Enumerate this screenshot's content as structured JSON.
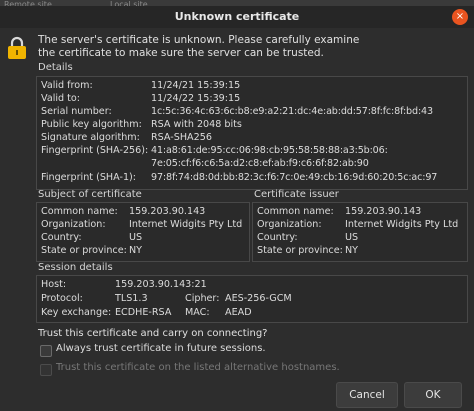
{
  "background": {
    "tabs": [
      "Remote site",
      "Local site"
    ]
  },
  "dialog": {
    "title": "Unknown certificate",
    "close_symbol": "×",
    "message_line1": "The server's certificate is unknown. Please carefully examine",
    "message_line2": "the certificate to make sure the server can be trusted.",
    "details": {
      "title": "Details",
      "rows": [
        {
          "label": "Valid from:",
          "value": "11/24/21 15:39:15"
        },
        {
          "label": "Valid to:",
          "value": "11/24/22 15:39:15"
        },
        {
          "label": "Serial number:",
          "value": "1c:5c:36:4c:63:6c:b8:e9:a2:21:dc:4e:ab:dd:57:8f:fc:8f:bd:43"
        },
        {
          "label": "Public key algorithm:",
          "value": "RSA with 2048 bits"
        },
        {
          "label": "Signature algorithm:",
          "value": "RSA-SHA256"
        },
        {
          "label": "Fingerprint (SHA-256):",
          "value": "41:a8:61:de:95:cc:06:98:cb:95:58:58:88:a3:5b:06:"
        },
        {
          "label": "",
          "value": "7e:05:cf:f6:c6:5a:d2:c8:ef:ab:f9:c6:6f:82:ab:90"
        },
        {
          "label": "Fingerprint (SHA-1):",
          "value": "97:8f:74:d8:0d:bb:82:3c:f6:7c:0e:49:cb:16:9d:60:20:5c:ac:97"
        }
      ]
    },
    "subject": {
      "title": "Subject of certificate",
      "rows": [
        {
          "label": "Common name:",
          "value": "159.203.90.143"
        },
        {
          "label": "Organization:",
          "value": "Internet Widgits Pty Ltd"
        },
        {
          "label": "Country:",
          "value": "US"
        },
        {
          "label": "State or province:",
          "value": "NY"
        }
      ]
    },
    "issuer": {
      "title": "Certificate issuer",
      "rows": [
        {
          "label": "Common name:",
          "value": "159.203.90.143"
        },
        {
          "label": "Organization:",
          "value": "Internet Widgits Pty Ltd"
        },
        {
          "label": "Country:",
          "value": "US"
        },
        {
          "label": "State or province:",
          "value": "NY"
        }
      ]
    },
    "session": {
      "title": "Session details",
      "host_label": "Host:",
      "host_value": "159.203.90.143:21",
      "protocol_label": "Protocol:",
      "protocol_value": "TLS1.3",
      "cipher_label": "Cipher:",
      "cipher_value": "AES-256-GCM",
      "kex_label": "Key exchange:",
      "kex_value": "ECDHE-RSA",
      "mac_label": "MAC:",
      "mac_value": "AEAD"
    },
    "question": "Trust this certificate and carry on connecting?",
    "always_trust_label": "Always trust certificate in future sessions.",
    "alt_hostnames_label": "Trust this certificate on the listed alternative hostnames.",
    "cancel_label": "Cancel",
    "ok_label": "OK"
  },
  "colors": {
    "close_button": "#e95420",
    "lock_icon": "#f0b400"
  }
}
